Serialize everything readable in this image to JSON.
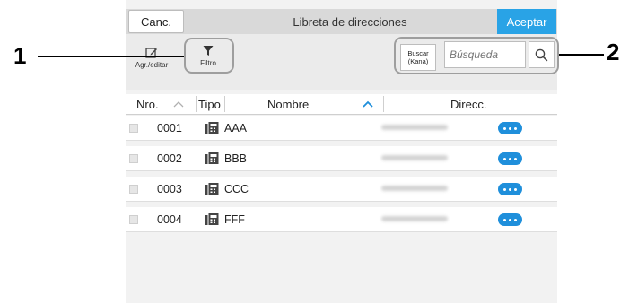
{
  "header": {
    "cancel_label": "Canc.",
    "title": "Libreta de direcciones",
    "accept_label": "Aceptar"
  },
  "toolbar": {
    "edit_label": "Agr./editar",
    "filter_label": "Filtro",
    "search_kana_line1": "Buscar",
    "search_kana_line2": "(Kana)",
    "search_placeholder": "Búsqueda"
  },
  "callouts": {
    "one": "1",
    "two": "2"
  },
  "table": {
    "headers": {
      "number": "Nro.",
      "type": "Tipo",
      "name": "Nombre",
      "address": "Direcc."
    },
    "rows": [
      {
        "number": "0001",
        "type_icon": "fax-icon",
        "name": "AAA"
      },
      {
        "number": "0002",
        "type_icon": "fax-icon",
        "name": "BBB"
      },
      {
        "number": "0003",
        "type_icon": "fax-icon",
        "name": "CCC"
      },
      {
        "number": "0004",
        "type_icon": "fax-icon",
        "name": "FFF"
      }
    ]
  },
  "colors": {
    "accent": "#29a3e6",
    "more_button": "#1f8fdb",
    "highlight": "#9e9e9e"
  }
}
